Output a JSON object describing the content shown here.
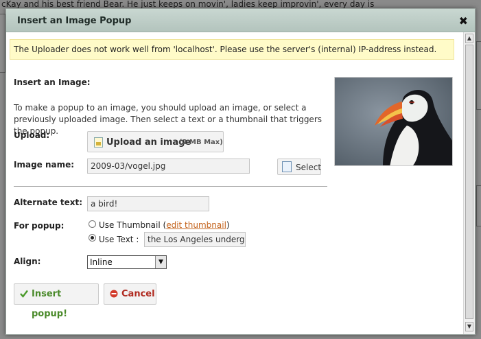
{
  "background": {
    "top_text": "cKay and his best friend Bear. He just keeps on movin', ladies keep improvin', every day is"
  },
  "dialog": {
    "title": "Insert an Image Popup",
    "close_label": "✖",
    "notice": "The Uploader does not work well from 'localhost'. Please use the server's (internal) IP-address instead.",
    "heading": "Insert an Image:",
    "description": "To make a popup to an image, you should upload an image, or select a previously uploaded image. Then select a text or a thumbnail that triggers the popup.",
    "upload": {
      "label": "Upload:",
      "button_text": "Upload an image",
      "max_text": "(2 MB Max)"
    },
    "image_name": {
      "label": "Image name:",
      "value": "2009-03/vogel.jpg",
      "select_label": "Select"
    },
    "alternate_text": {
      "label": "Alternate text:",
      "value": "a bird!"
    },
    "for_popup": {
      "label": "For popup:",
      "option_thumbnail": "Use Thumbnail (",
      "edit_thumbnail_link": "edit thumbnail",
      "option_thumbnail_close": ")",
      "option_text": "Use Text :",
      "text_value": "the Los Angeles undergr",
      "selected": "text"
    },
    "align": {
      "label": "Align:",
      "value": "Inline"
    },
    "buttons": {
      "insert": "Insert popup!",
      "cancel": "Cancel"
    }
  },
  "colors": {
    "titlebar": "#bccbc5",
    "notice_bg": "#fffbc8",
    "link": "#c4631c",
    "insert_text": "#4a8a2a",
    "cancel_text": "#b02a20"
  },
  "icons": {
    "close": "close-icon",
    "upload": "image-upload-icon",
    "select": "document-icon",
    "insert": "checkmark-icon",
    "cancel": "cancel-circle-icon",
    "dropdown": "chevron-down-icon"
  }
}
